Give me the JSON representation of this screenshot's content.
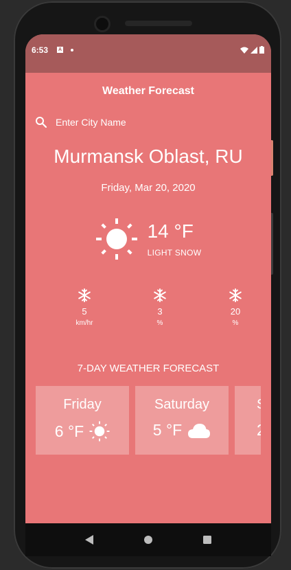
{
  "status_bar": {
    "time": "6:53",
    "notification_icon": "A"
  },
  "app": {
    "title": "Weather Forecast"
  },
  "search": {
    "placeholder": "Enter City Name",
    "value": ""
  },
  "location": {
    "city": "Murmansk Oblast, RU",
    "date": "Friday, Mar 20, 2020"
  },
  "current": {
    "temperature": "14 °F",
    "condition": "LIGHT SNOW",
    "icon": "sun-icon"
  },
  "stats": [
    {
      "icon": "snowflake-icon",
      "value": "5",
      "unit": "km/hr"
    },
    {
      "icon": "snowflake-icon",
      "value": "3",
      "unit": "%"
    },
    {
      "icon": "snowflake-icon",
      "value": "20",
      "unit": "%"
    }
  ],
  "forecast": {
    "title": "7-DAY WEATHER FORECAST",
    "days": [
      {
        "day": "Friday",
        "temp": "6 °F",
        "icon": "sun-icon"
      },
      {
        "day": "Saturday",
        "temp": "5 °F",
        "icon": "cloud-icon"
      },
      {
        "day": "S",
        "temp": "2",
        "icon": ""
      }
    ]
  },
  "colors": {
    "background": "#e87677",
    "status_bar": "#a65a5a",
    "text": "#ffffff"
  }
}
